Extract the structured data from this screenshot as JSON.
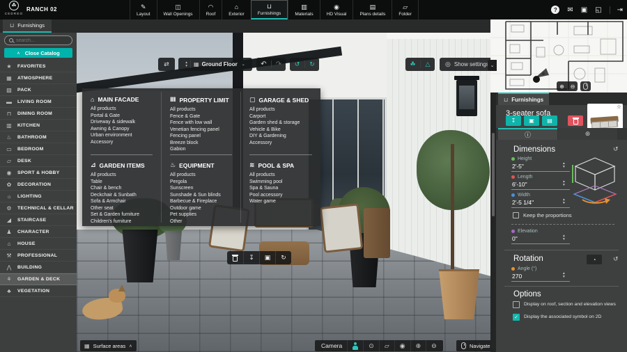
{
  "topbar": {
    "brand": "CEDREO",
    "project": "RANCH 02",
    "tools": [
      {
        "label": "Layout",
        "icon": "✎"
      },
      {
        "label": "Wall Openings",
        "icon": "◫"
      },
      {
        "label": "Roof",
        "icon": "◠"
      },
      {
        "label": "Exterior",
        "icon": "⌂"
      },
      {
        "label": "Furnishings",
        "icon": "⊔",
        "active": true
      },
      {
        "label": "Materials",
        "icon": "▥"
      },
      {
        "label": "HD Visual",
        "icon": "◉"
      },
      {
        "label": "Plans details",
        "icon": "▤"
      },
      {
        "label": "Folder",
        "icon": "▱"
      }
    ],
    "right_icons": {
      "help": "?",
      "comments": "✉",
      "save": "▣",
      "compress": "◱",
      "exit": "⇥"
    }
  },
  "tabbar": {
    "active_tab": "Furnishings"
  },
  "sidebar": {
    "search_placeholder": "search...",
    "close_catalog": "Close Catalog",
    "items": [
      {
        "label": "FAVORITES",
        "icon": "★"
      },
      {
        "label": "ATMOSPHERE",
        "icon": "▦"
      },
      {
        "label": "PACK",
        "icon": "▧"
      },
      {
        "label": "LIVING ROOM",
        "icon": "▬"
      },
      {
        "label": "DINING ROOM",
        "icon": "⊓"
      },
      {
        "label": "KITCHEN",
        "icon": "▥"
      },
      {
        "label": "BATHROOM",
        "icon": "♨"
      },
      {
        "label": "BEDROOM",
        "icon": "▭"
      },
      {
        "label": "DESK",
        "icon": "▱"
      },
      {
        "label": "SPORT & HOBBY",
        "icon": "◉"
      },
      {
        "label": "DECORATION",
        "icon": "✿"
      },
      {
        "label": "LIGHTING",
        "icon": "☼"
      },
      {
        "label": "TECHNICAL & CELLAR",
        "icon": "⚙"
      },
      {
        "label": "STAIRCASE",
        "icon": "◢"
      },
      {
        "label": "CHARACTER",
        "icon": "♟"
      },
      {
        "label": "HOUSE",
        "icon": "⌂"
      },
      {
        "label": "PROFESSIONAL",
        "icon": "⚒"
      },
      {
        "label": "BUILDING",
        "icon": "⋀"
      },
      {
        "label": "GARDEN & DECK",
        "icon": "⚘",
        "active": true
      },
      {
        "label": "VEGETATION",
        "icon": "♣"
      }
    ]
  },
  "viewport": {
    "floor_selector": "Ground Floor",
    "show_settings": "Show settings",
    "surface_areas": "Surface areas",
    "camera": "Camera",
    "navigate": "Navigate"
  },
  "catalog": {
    "columns": [
      {
        "title": "MAIN FACADE",
        "icon": "⌂",
        "items": [
          "All products",
          "Portal & Gate",
          "Driveway & sidewalk",
          "Awning & Canopy",
          "Urban environment",
          "Accessory"
        ]
      },
      {
        "title": "PROPERTY LIMIT",
        "icon": "Ⅲ",
        "items": [
          "All products",
          "Fence & Gate",
          "Fence with low wall",
          "Venetian fencing panel",
          "Fencing panel",
          "Breeze block",
          "Gabion"
        ]
      },
      {
        "title": "GARAGE & SHED",
        "icon": "▢",
        "items": [
          "All products",
          "Carport",
          "Garden shed & storage",
          "Vehicle & Bike",
          "DIY & Gardening",
          "Accessory"
        ]
      },
      {
        "title": "GARDEN ITEMS",
        "icon": "⊿",
        "items": [
          "All products",
          "Table",
          "Chair & bench",
          "Deckchair & Sunbath",
          "Sofa & Armchair",
          "Other seat",
          "Set & Garden furniture",
          "Children's furniture"
        ]
      },
      {
        "title": "EQUIPMENT",
        "icon": "♨",
        "items": [
          "All products",
          "Pergola",
          "Sunscreen",
          "Sunshade & Sun blinds",
          "Barbecue & Fireplace",
          "Outdoor game",
          "Pet supplies",
          "Other"
        ]
      },
      {
        "title": "POOL & SPA",
        "icon": "≋",
        "items": [
          "All products",
          "Swimming pool",
          "Spa & Sauna",
          "Pool accessory",
          "Water game"
        ]
      }
    ]
  },
  "inspector": {
    "tab": "Furnishings",
    "item_name": "3-seater sofa",
    "dimensions": {
      "title": "Dimensions",
      "height_label": "Height",
      "height_value": "2'-5\"",
      "length_label": "Length",
      "length_value": "6'-10\"",
      "width_label": "Width",
      "width_value": "2'-5 1/4\"",
      "keep_proportions": "Keep the proportions",
      "elevation_label": "Elevation",
      "elevation_value": "0\""
    },
    "rotation": {
      "title": "Rotation",
      "angle_label": "Angle (°)",
      "angle_value": "270"
    },
    "options": {
      "title": "Options",
      "option_roof": "Display on roof, section and elevation views",
      "option_symbol": "Display the associated symbol on 2D"
    }
  },
  "icons": {
    "chevron_up": "∧",
    "chevron_down": "⌄",
    "spin_up": "▴",
    "spin_down": "▾",
    "swap": "⇄",
    "floor": "▦",
    "undo": "↶",
    "redo": "↷",
    "refresh": "↺",
    "sync": "↻",
    "vegetation": "☘",
    "terrain": "△",
    "eye": "◎",
    "surface": "▦",
    "view_eye": "⊙",
    "elevation_cam": "▱",
    "binoculars": "◉",
    "zoom_in": "⊕",
    "zoom_out": "⊖",
    "download": "↧",
    "copy": "▣",
    "replace": "▤",
    "star": "☆",
    "info": "ⓘ",
    "palette": "⊛",
    "reset": "↺",
    "protractor": "◔",
    "check": "✓",
    "furnishings": "⊔"
  },
  "colors": {
    "accent": "#00b3ab",
    "danger": "#e0535f",
    "height_dot": "#6abf59",
    "length_dot": "#e05555",
    "width_dot": "#4a90d9",
    "elevation_dot": "#a868c9",
    "angle_dot": "#e8922e"
  }
}
